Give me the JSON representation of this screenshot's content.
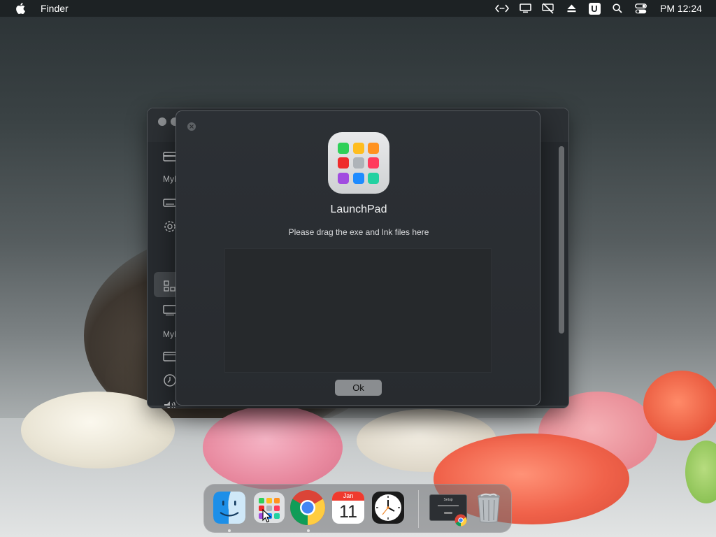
{
  "menubar": {
    "app_name": "Finder",
    "clock": "PM 12:24",
    "tray_icons": [
      "code-arrows-icon",
      "display-icon",
      "muted-display-icon",
      "eject-icon",
      "u-app-icon",
      "search-icon",
      "control-center-icon"
    ],
    "u_label": "U"
  },
  "back_window": {
    "sidebar_labels": [
      "MyI",
      "MyI"
    ]
  },
  "dialog": {
    "title": "LaunchPad",
    "subtitle": "Please drag the exe and lnk files here",
    "ok_label": "Ok",
    "icon_colors": [
      "#2fd058",
      "#ffbd1f",
      "#ff9220",
      "#ef2b2b",
      "#aeb3b8",
      "#ff3b5c",
      "#a14ce0",
      "#1e8bff",
      "#22d1a1"
    ]
  },
  "dock": {
    "items": [
      "finder-icon",
      "launchpad-icon",
      "chrome-icon",
      "calendar-icon",
      "clock-icon",
      "window-preview-icon",
      "trash-icon"
    ],
    "calendar_month": "Jan",
    "calendar_day": "11",
    "preview_title": "Setup"
  }
}
